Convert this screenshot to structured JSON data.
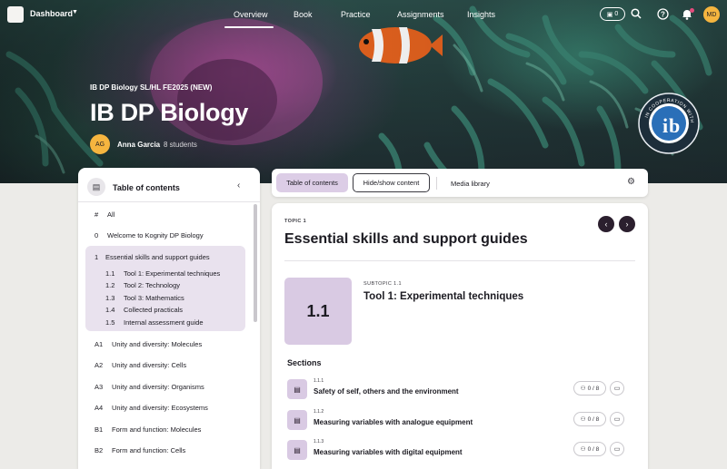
{
  "nav": {
    "dashboard": "Dashboard",
    "tabs": [
      "Overview",
      "Book",
      "Practice",
      "Assignments",
      "Insights"
    ],
    "active_tab": "Overview",
    "cart_count": "0",
    "user_initials": "MD"
  },
  "course": {
    "subtitle": "IB DP Biology SL/HL FE2025 (NEW)",
    "title": "IB DP Biology",
    "teacher_initials": "AG",
    "teacher": "Anna Garcia",
    "students": "8 students",
    "seal_text": "IN COOPERATION WITH"
  },
  "toc": {
    "title": "Table of contents",
    "items": [
      {
        "num": "#",
        "label": "All"
      },
      {
        "num": "0",
        "label": "Welcome to Kognity DP Biology"
      },
      {
        "num": "1",
        "label": "Essential skills and support guides"
      },
      {
        "num": "1.1",
        "label": "Tool 1: Experimental techniques"
      },
      {
        "num": "1.2",
        "label": "Tool 2: Technology"
      },
      {
        "num": "1.3",
        "label": "Tool 3: Mathematics"
      },
      {
        "num": "1.4",
        "label": "Collected practicals"
      },
      {
        "num": "1.5",
        "label": "Internal assessment guide"
      },
      {
        "num": "A1",
        "label": "Unity and diversity: Molecules"
      },
      {
        "num": "A2",
        "label": "Unity and diversity: Cells"
      },
      {
        "num": "A3",
        "label": "Unity and diversity: Organisms"
      },
      {
        "num": "A4",
        "label": "Unity and diversity: Ecosystems"
      },
      {
        "num": "B1",
        "label": "Form and function: Molecules"
      },
      {
        "num": "B2",
        "label": "Form and function: Cells"
      }
    ]
  },
  "toolbar": {
    "toc": "Table of contents",
    "hide_show": "Hide/show content",
    "media": "Media library"
  },
  "content": {
    "topic_label": "TOPIC 1",
    "topic_title": "Essential skills and support guides",
    "subtopic_num": "1.1",
    "subtopic_label": "SUBTOPIC 1.1",
    "subtopic_title": "Tool 1: Experimental techniques",
    "sections_heading": "Sections",
    "sections": [
      {
        "num": "1.1.1",
        "title": "Safety of self, others and the environment",
        "progress": "0 / 8"
      },
      {
        "num": "1.1.2",
        "title": "Measuring variables with analogue equipment",
        "progress": "0 / 8"
      },
      {
        "num": "1.1.3",
        "title": "Measuring variables with digital equipment",
        "progress": "0 / 8"
      }
    ]
  },
  "colors": {
    "accent_light": "#dccde6",
    "dark_button": "#2b1f2e",
    "avatar": "#f5b53f"
  }
}
